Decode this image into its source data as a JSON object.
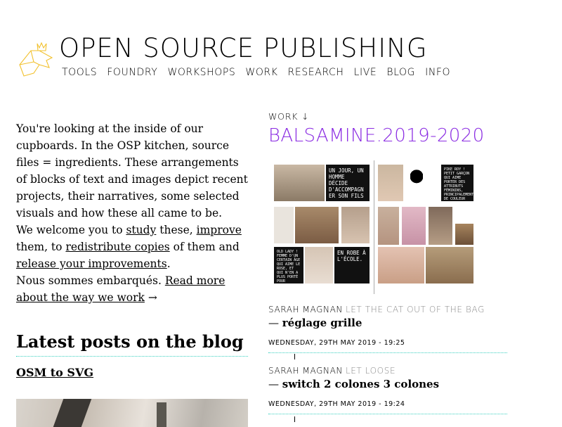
{
  "site": {
    "title": "OPEN SOURCE PUBLISHING",
    "logo_icon": "osp-crown-bird-icon",
    "accent_color": "#f2c12e"
  },
  "nav": [
    {
      "label": "TOOLS"
    },
    {
      "label": "FOUNDRY"
    },
    {
      "label": "WORKSHOPS"
    },
    {
      "label": "WORK"
    },
    {
      "label": "RESEARCH"
    },
    {
      "label": "LIVE"
    },
    {
      "label": "BLOG"
    },
    {
      "label": "INFO"
    }
  ],
  "intro": {
    "p1": "You're looking at the inside of our cupboards. In the OSP kitchen, source files = ingredients. These arrangements of blocks of text and images depict recent projects, their narratives, some selected visuals and how these all came to be.",
    "p2_a": "We welcome you to ",
    "link_study": "study",
    "p2_b": " these, ",
    "link_improve": "improve",
    "p2_c": " them, to ",
    "link_redistribute": "redistribute copies",
    "p2_d": " of them and ",
    "link_release": "release your improvements",
    "p2_e": ".",
    "p3_a": "Nous sommes embarqués. ",
    "link_readmore": "Read more about the way we work",
    "arrow": " →"
  },
  "blog": {
    "heading": "Latest posts on the blog",
    "post_title": "OSM to SVG"
  },
  "work": {
    "label": "WORK ↓",
    "title": "BALSAMINE.2019-2020",
    "title_color": "#8a2be2",
    "visual_texts": {
      "box1": "UN JOUR, UN HOMME DÉCIDE D'ACCOMPAGN ER SON FILS",
      "box2": "PIKE ROY ! PETIT GARÇON QUI AIME PORTER DES ATTRIBUTS FÉMININS, PRINCIPALEMENT DE COULEUR ROSE.",
      "box3": "OLD LADY ! FEMME D'UN CERTAIN ÂGE QUI AIME LE ROSE, ET QUI N'EN A PLUS PORTÉ POUR LONGTEMPS.",
      "box4": "EN ROBE À L'ÉCOLE."
    }
  },
  "commits": [
    {
      "author": "SARAH MAGNAN",
      "repo": "LET THE CAT OUT OF THE BAG",
      "dash": "— ",
      "message": "réglage grille",
      "date": "WEDNESDAY, 29TH MAY 2019 - 19:25"
    },
    {
      "author": "SARAH MAGNAN",
      "repo": "LET LOOSE",
      "dash": "— ",
      "message": "switch 2 colones 3 colones",
      "date": "WEDNESDAY, 29TH MAY 2019 - 19:24"
    }
  ]
}
